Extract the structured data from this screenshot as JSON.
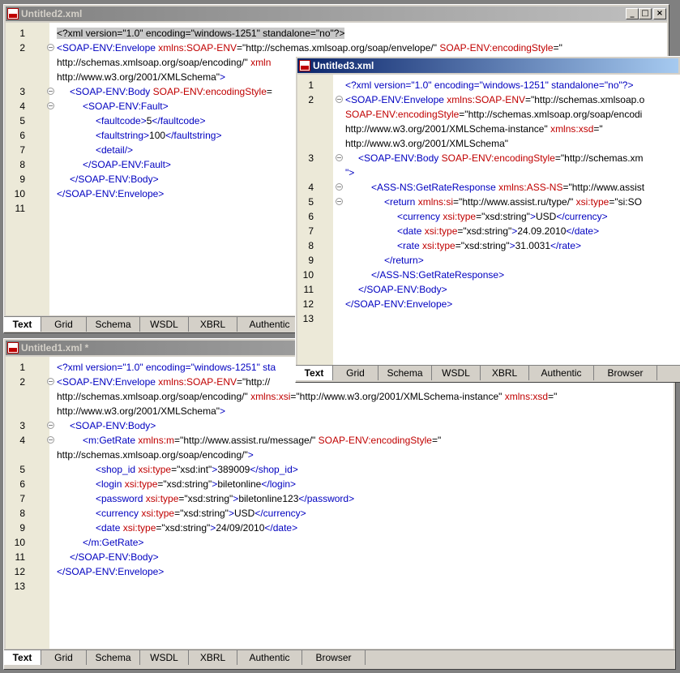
{
  "tabs": [
    "Text",
    "Grid",
    "Schema",
    "WSDL",
    "XBRL",
    "Authentic",
    "Browser"
  ],
  "tab_truncated": "Authentic",
  "window_controls": {
    "minimize": "_",
    "maximize": "□",
    "close": "×"
  },
  "win2": {
    "title": "Untitled2.xml",
    "lines": [
      {
        "n": "1",
        "html": "<span class='hl'>&lt;?xml version=\"1.0\" encoding=\"windows-1251\" standalone=\"no\"?&gt;</span>"
      },
      {
        "n": "2",
        "fold": true,
        "html": "<span class='b'>&lt;SOAP-ENV:Envelope</span> <span class='r'>xmlns:SOAP-ENV</span>=\"http://schemas.xmlsoap.org/soap/envelope/\" <span class='r'>SOAP-ENV:encodingStyle</span>=\""
      },
      {
        "n": "",
        "html": "http://schemas.xmlsoap.org/soap/encoding/\" <span class='r'>xmln</span>"
      },
      {
        "n": "",
        "html": "http://www.w3.org/2001/XMLSchema\"<span class='b'>&gt;</span>"
      },
      {
        "n": "3",
        "fold": true,
        "indent": 1,
        "html": "<span class='b'>&lt;SOAP-ENV:Body</span> <span class='r'>SOAP-ENV:encodingStyle</span>="
      },
      {
        "n": "4",
        "fold": true,
        "indent": 2,
        "html": "<span class='b'>&lt;SOAP-ENV:Fault&gt;</span>"
      },
      {
        "n": "5",
        "indent": 3,
        "html": "<span class='b'>&lt;faultcode&gt;</span>5<span class='b'>&lt;/faultcode&gt;</span>"
      },
      {
        "n": "6",
        "indent": 3,
        "html": "<span class='b'>&lt;faultstring&gt;</span>100<span class='b'>&lt;/faultstring&gt;</span>"
      },
      {
        "n": "7",
        "indent": 3,
        "html": "<span class='b'>&lt;detail/&gt;</span>"
      },
      {
        "n": "8",
        "indent": 2,
        "html": "<span class='b'>&lt;/SOAP-ENV:Fault&gt;</span>"
      },
      {
        "n": "9",
        "indent": 1,
        "html": "<span class='b'>&lt;/SOAP-ENV:Body&gt;</span>"
      },
      {
        "n": "10",
        "indent": 0,
        "html": "<span class='b'>&lt;/SOAP-ENV:Envelope&gt;</span>"
      },
      {
        "n": "11",
        "html": ""
      }
    ]
  },
  "win3": {
    "title": "Untitled3.xml",
    "lines": [
      {
        "n": "1",
        "html": "<span class='b'>&lt;?xml version=\"1.0\" encoding=\"windows-1251\" standalone=\"no\"?&gt;</span>"
      },
      {
        "n": "2",
        "fold": true,
        "html": "<span class='b'>&lt;SOAP-ENV:Envelope</span> <span class='r'>xmlns:SOAP-ENV</span>=\"http://schemas.xmlsoap.o"
      },
      {
        "n": "",
        "html": "<span class='r'>SOAP-ENV:encodingStyle</span>=\"http://schemas.xmlsoap.org/soap/encodi"
      },
      {
        "n": "",
        "html": "http://www.w3.org/2001/XMLSchema-instance\" <span class='r'>xmlns:xsd</span>=\""
      },
      {
        "n": "",
        "html": "http://www.w3.org/2001/XMLSchema\""
      },
      {
        "n": "3",
        "fold": true,
        "indent": 1,
        "html": "<span class='b'>&lt;SOAP-ENV:Body</span> <span class='r'>SOAP-ENV:encodingStyle</span>=\"http://schemas.xm"
      },
      {
        "n": "",
        "html": "<span class='b'>\"&gt;</span>"
      },
      {
        "n": "4",
        "fold": true,
        "indent": 2,
        "html": "<span class='b'>&lt;ASS-NS:GetRateResponse</span> <span class='r'>xmlns:ASS-NS</span>=\"http://www.assist"
      },
      {
        "n": "5",
        "fold": true,
        "indent": 3,
        "html": "<span class='b'>&lt;return</span> <span class='r'>xmlns:si</span>=\"http://www.assist.ru/type/\" <span class='r'>xsi:type</span>=\"si:SO"
      },
      {
        "n": "6",
        "indent": 4,
        "html": "<span class='b'>&lt;currency</span> <span class='r'>xsi:type</span>=\"xsd:string\"<span class='b'>&gt;</span>USD<span class='b'>&lt;/currency&gt;</span>"
      },
      {
        "n": "7",
        "indent": 4,
        "html": "<span class='b'>&lt;date</span> <span class='r'>xsi:type</span>=\"xsd:string\"<span class='b'>&gt;</span>24.09.2010<span class='b'>&lt;/date&gt;</span>"
      },
      {
        "n": "8",
        "indent": 4,
        "html": "<span class='b'>&lt;rate</span> <span class='r'>xsi:type</span>=\"xsd:string\"<span class='b'>&gt;</span>31.0031<span class='b'>&lt;/rate&gt;</span>"
      },
      {
        "n": "9",
        "indent": 3,
        "html": "<span class='b'>&lt;/return&gt;</span>"
      },
      {
        "n": "10",
        "indent": 2,
        "html": "<span class='b'>&lt;/ASS-NS:GetRateResponse&gt;</span>"
      },
      {
        "n": "11",
        "indent": 1,
        "html": "<span class='b'>&lt;/SOAP-ENV:Body&gt;</span>"
      },
      {
        "n": "12",
        "indent": 0,
        "html": "<span class='b'>&lt;/SOAP-ENV:Envelope&gt;</span>"
      },
      {
        "n": "13",
        "html": ""
      }
    ]
  },
  "win1": {
    "title": "Untitled1.xml *",
    "lines": [
      {
        "n": "1",
        "html": "<span class='b'>&lt;?xml version=\"1.0\" encoding=\"windows-1251\" sta</span>"
      },
      {
        "n": "2",
        "fold": true,
        "html": "<span class='b'>&lt;SOAP-ENV:Envelope</span> <span class='r'>xmlns:SOAP-ENV</span>=\"http://"
      },
      {
        "n": "",
        "html": "http://schemas.xmlsoap.org/soap/encoding/\" <span class='r'>xmlns:xsi</span>=\"http://www.w3.org/2001/XMLSchema-instance\" <span class='r'>xmlns:xsd</span>=\""
      },
      {
        "n": "",
        "html": "http://www.w3.org/2001/XMLSchema\"<span class='b'>&gt;</span>"
      },
      {
        "n": "3",
        "fold": true,
        "indent": 1,
        "html": "<span class='b'>&lt;SOAP-ENV:Body&gt;</span>"
      },
      {
        "n": "4",
        "fold": true,
        "indent": 2,
        "html": "<span class='b'>&lt;m:GetRate</span> <span class='r'>xmlns:m</span>=\"http://www.assist.ru/message/\" <span class='r'>SOAP-ENV:encodingStyle</span>=\""
      },
      {
        "n": "",
        "html": "http://schemas.xmlsoap.org/soap/encoding/\"<span class='b'>&gt;</span>"
      },
      {
        "n": "5",
        "indent": 3,
        "html": "<span class='b'>&lt;shop_id</span> <span class='r'>xsi:type</span>=\"xsd:int\"<span class='b'>&gt;</span>389009<span class='b'>&lt;/shop_id&gt;</span>"
      },
      {
        "n": "6",
        "indent": 3,
        "html": "<span class='b'>&lt;login</span> <span class='r'>xsi:type</span>=\"xsd:string\"<span class='b'>&gt;</span>biletonline<span class='b'>&lt;/login&gt;</span>"
      },
      {
        "n": "7",
        "indent": 3,
        "html": "<span class='b'>&lt;password</span> <span class='r'>xsi:type</span>=\"xsd:string\"<span class='b'>&gt;</span>biletonline123<span class='b'>&lt;/password&gt;</span>"
      },
      {
        "n": "8",
        "indent": 3,
        "html": "<span class='b'>&lt;currency</span> <span class='r'>xsi:type</span>=\"xsd:string\"<span class='b'>&gt;</span>USD<span class='b'>&lt;/currency&gt;</span>"
      },
      {
        "n": "9",
        "indent": 3,
        "html": "<span class='b'>&lt;date</span> <span class='r'>xsi:type</span>=\"xsd:string\"<span class='b'>&gt;</span>24/09/2010<span class='b'>&lt;/date&gt;</span>"
      },
      {
        "n": "10",
        "indent": 2,
        "html": "<span class='b'>&lt;/m:GetRate&gt;</span>"
      },
      {
        "n": "11",
        "indent": 1,
        "html": "<span class='b'>&lt;/SOAP-ENV:Body&gt;</span>"
      },
      {
        "n": "12",
        "indent": 0,
        "html": "<span class='b'>&lt;/SOAP-ENV:Envelope&gt;</span>"
      },
      {
        "n": "13",
        "html": ""
      }
    ]
  }
}
